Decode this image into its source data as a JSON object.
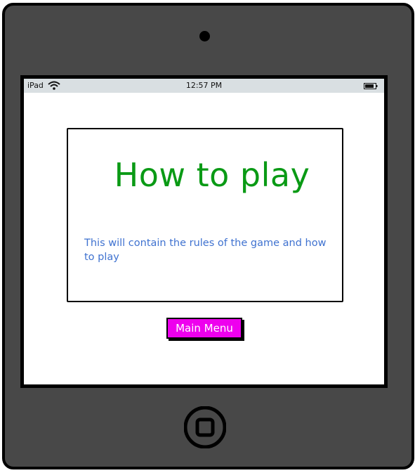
{
  "status_bar": {
    "device": "iPad",
    "time": "12:57 PM",
    "wifi_icon": "wifi-icon",
    "battery_icon": "battery-icon"
  },
  "card": {
    "title": "How to play",
    "description": "This will contain the rules of the game and how to play"
  },
  "actions": {
    "main_menu_label": "Main Menu"
  },
  "colors": {
    "title": "#0a9a15",
    "description": "#3f72d0",
    "button_bg": "#ee00ee",
    "frame": "#484848",
    "status_bar": "#d9dfe2"
  },
  "hardware": {
    "camera_icon": "camera-icon",
    "home_button_icon": "home-button-icon"
  }
}
